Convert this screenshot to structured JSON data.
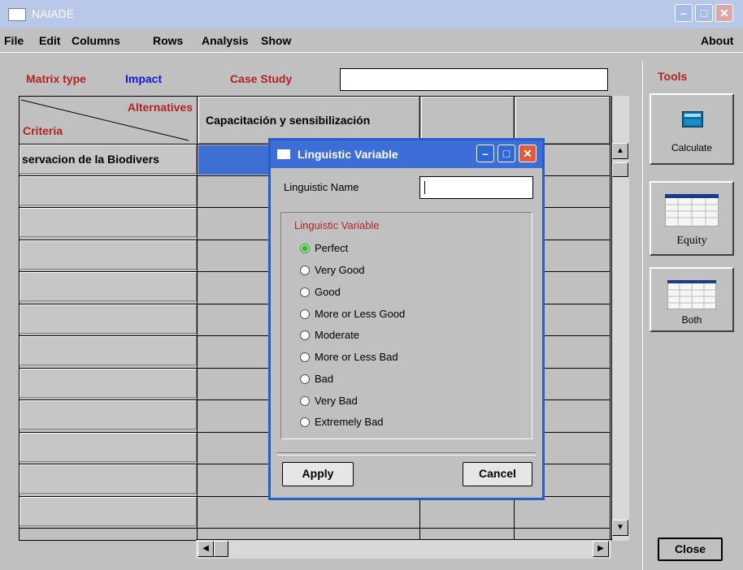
{
  "window": {
    "title": "NAIADE",
    "min": "–",
    "max": "□",
    "close": "✕"
  },
  "menu": {
    "items": [
      "File",
      "Edit",
      "Columns",
      "Rows",
      "Analysis",
      "Show"
    ],
    "about": "About"
  },
  "header": {
    "matrix_type_label": "Matrix type",
    "matrix_type_value": "Impact",
    "case_study_label": "Case Study",
    "case_study_value": ""
  },
  "grid": {
    "corner_top": "Alternatives",
    "corner_bottom": "Criteria",
    "column_headers": [
      "Capacitación y sensibilización",
      "",
      ""
    ],
    "row_headers": [
      "servacion de la Biodivers"
    ]
  },
  "tools": {
    "title": "Tools",
    "calculate_label": "Calculate",
    "equity_label": "Equity",
    "both_label": "Both",
    "close_label": "Close"
  },
  "dialog": {
    "title": "Linguistic Variable",
    "name_label": "Linguistic Name",
    "name_value": "",
    "group_label": "Linguistic Variable",
    "options": [
      "Perfect",
      "Very Good",
      "Good",
      "More or Less Good",
      "Moderate",
      "More or Less Bad",
      "Bad",
      "Very Bad",
      "Extremely Bad"
    ],
    "selected": "Perfect",
    "apply_label": "Apply",
    "cancel_label": "Cancel"
  },
  "colors": {
    "label_red": "#b22222",
    "label_blue": "#1515d6",
    "dialog_blue": "#3d6ed7",
    "selection_blue": "#3f6fd2"
  }
}
